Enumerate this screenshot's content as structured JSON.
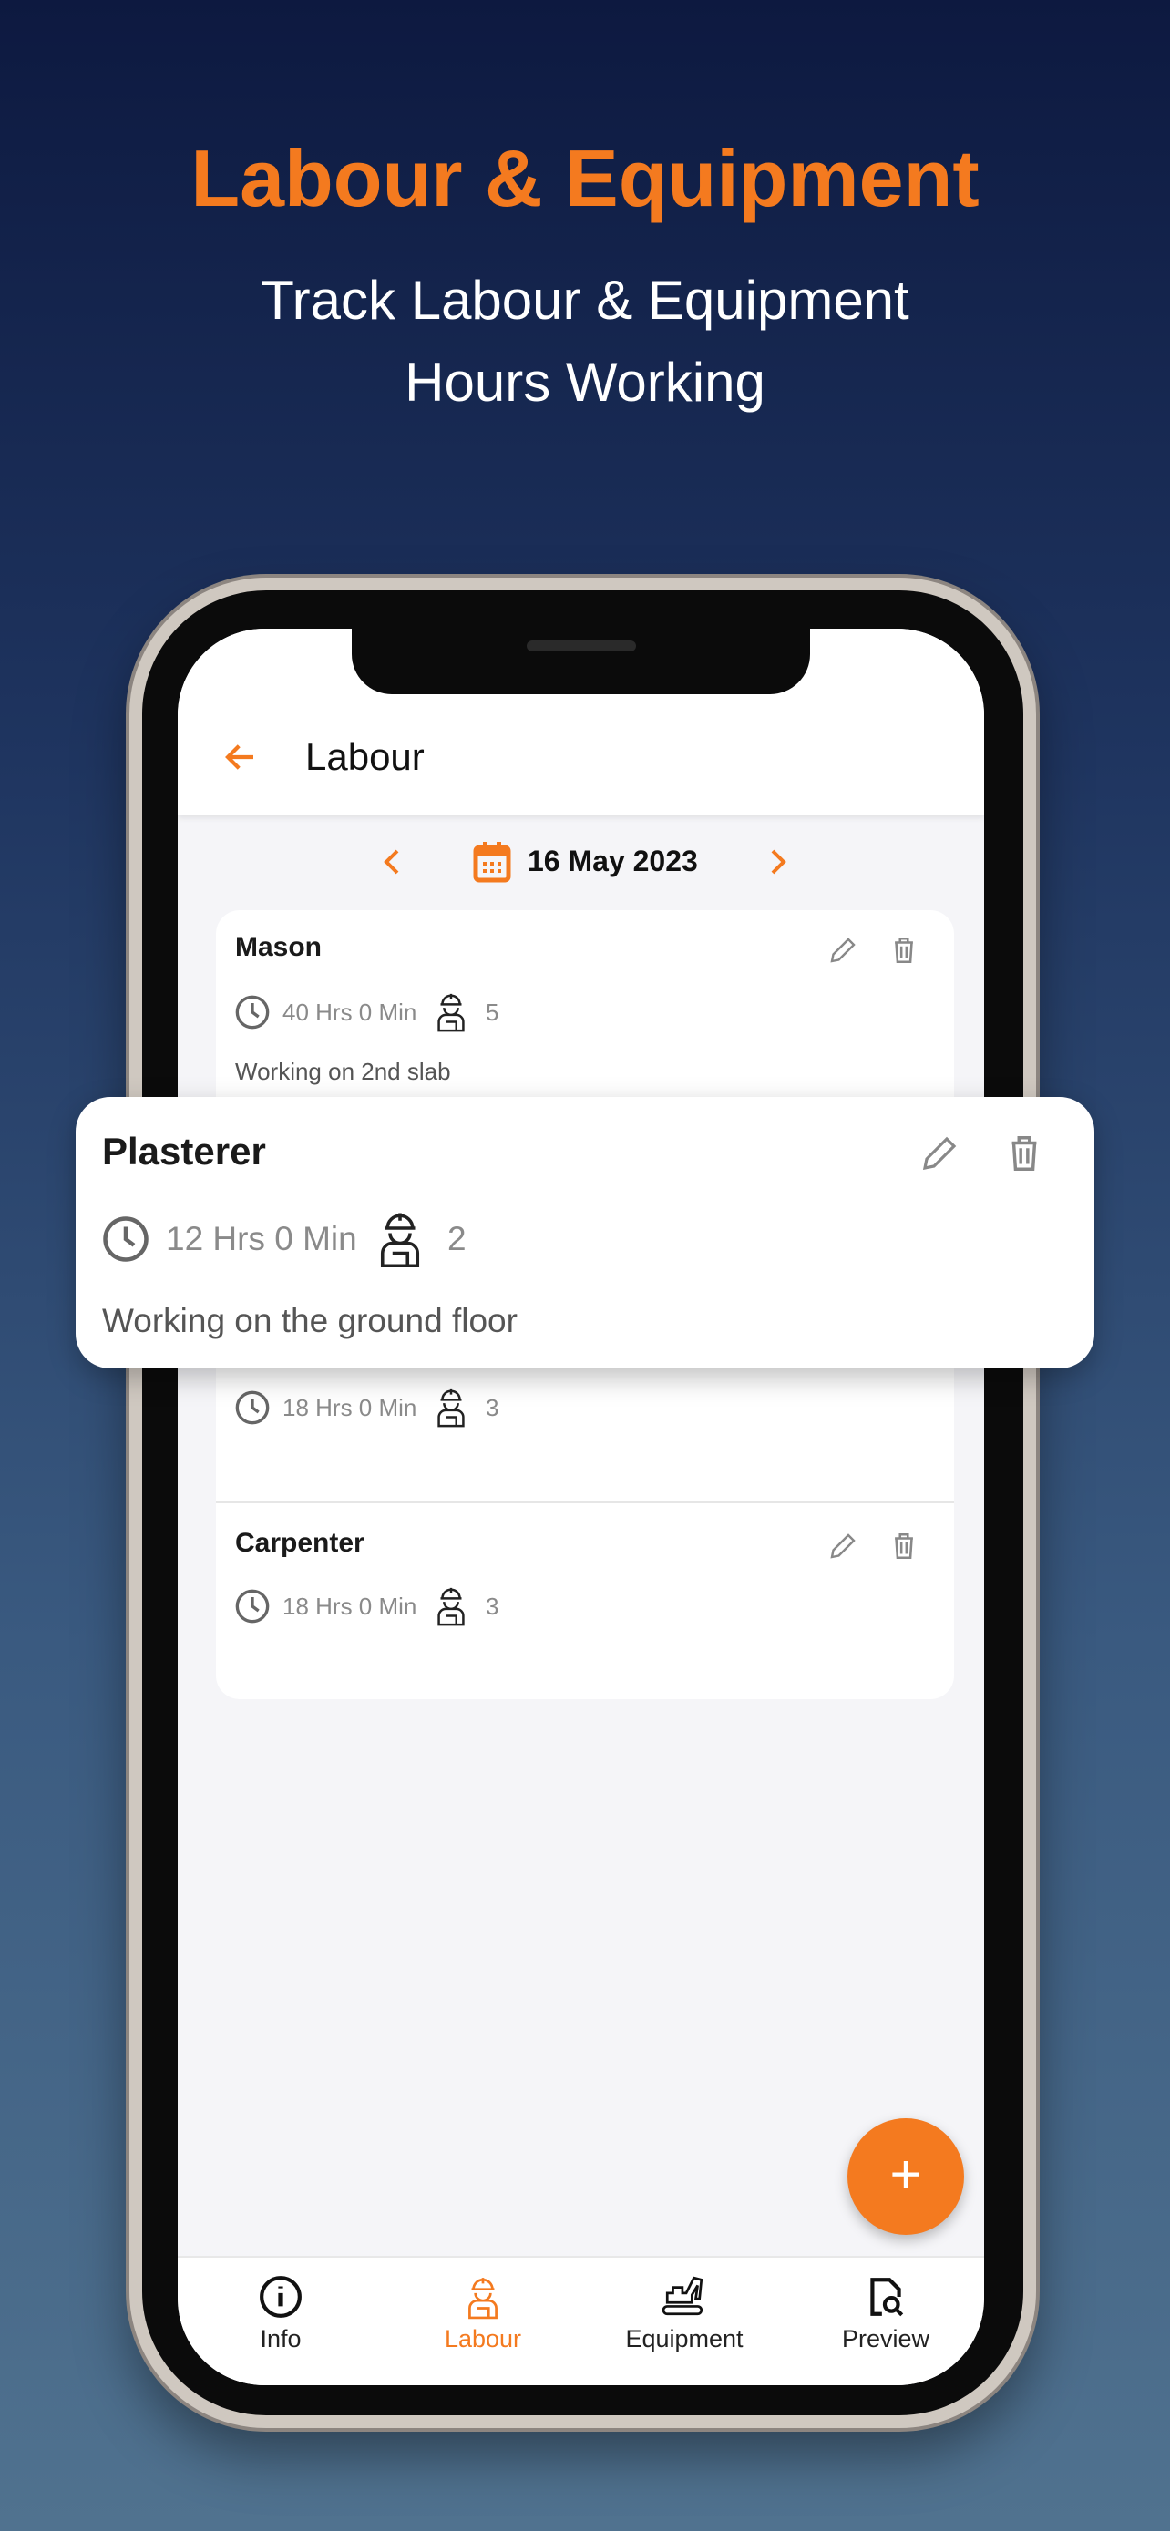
{
  "hero": {
    "title": "Labour & Equipment",
    "subtitle_line1": "Track Labour & Equipment",
    "subtitle_line2": "Hours Working"
  },
  "header": {
    "title": "Labour"
  },
  "date": {
    "value": "16 May 2023"
  },
  "entries": [
    {
      "title": "Mason",
      "hours": "40 Hrs 0 Min",
      "workers": "5",
      "description": "Working on 2nd slab"
    },
    {
      "hours": "18 Hrs 0 Min",
      "workers": "3"
    },
    {
      "title": "Carpenter",
      "hours": "18 Hrs 0 Min",
      "workers": "3"
    }
  ],
  "highlight": {
    "title": "Plasterer",
    "hours": "12 Hrs 0 Min",
    "workers": "2",
    "description": "Working on the ground floor"
  },
  "fab": {
    "label": "+"
  },
  "nav": [
    {
      "label": "Info",
      "icon": "info-icon"
    },
    {
      "label": "Labour",
      "icon": "worker-icon",
      "active": true
    },
    {
      "label": "Equipment",
      "icon": "excavator-icon"
    },
    {
      "label": "Preview",
      "icon": "document-search-icon"
    }
  ],
  "colors": {
    "accent": "#f47a1f",
    "background_top": "#0d1940",
    "background_bottom": "#50728f"
  }
}
